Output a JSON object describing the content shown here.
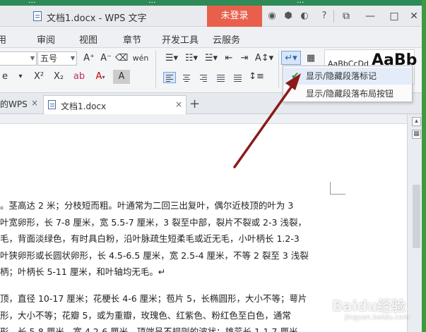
{
  "desktop_strip": [
    "...",
    "...",
    "..."
  ],
  "titlebar": {
    "doc_title": "文档1.docx - WPS 文字",
    "login_label": "未登录"
  },
  "menu": [
    "审阅",
    "视图",
    "章节",
    "开发工具",
    "云服务"
  ],
  "ribbon": {
    "font_size": "五号",
    "font_grow": "A⁺",
    "font_shrink": "A⁻",
    "superscript": "X²",
    "subscript": "X₂",
    "style_normal": "AaBbCcDd",
    "style_heading": "AaBb"
  },
  "tabs": {
    "prev_tab": "的WPS",
    "active_tab": "文档1.docx",
    "close_symbol": "×",
    "add_symbol": "+"
  },
  "dropdown": {
    "items": [
      "显示/隐藏段落标记",
      "显示/隐藏段落布局按钮"
    ]
  },
  "document": {
    "para1": [
      "。茎高达 2 米；分枝短而粗。叶通常为二回三出复叶，偶尔近枝顶的叶为 3",
      "叶宽卵形，长 7-8 厘米，宽 5.5-7 厘米，3 裂至中部，裂片不裂或 2-3 浅裂，",
      "毛，背面淡绿色，有时具白粉，沿叶脉疏生短柔毛或近无毛，小叶柄长 1.2-3",
      "叶狭卵形或长圆状卵形，长 4.5-6.5 厘米，宽 2.5-4 厘米，不等 2 裂至 3 浅裂",
      "柄；叶柄长 5-11 厘米，和叶轴均无毛。↵"
    ],
    "para2": [
      "顶，直径 10-17 厘米；花梗长 4-6 厘米；苞片 5，长椭圆形，大小不等；萼片",
      "形，大小不等；花瓣 5，或为重瓣，玫瑰色、红紫色、粉红色至白色，通常",
      "形，长 5-8 厘米，宽 4.2-6 厘米，顶端呈不规则的波状；雄蕊长 1-1.7 厘米"
    ]
  },
  "watermark": {
    "main": "Baidu经验",
    "sub": "jingyan.baidu.com"
  },
  "colors": {
    "login_bg": "#e8604c",
    "arrow": "#8b1a1a",
    "check": "#2b8f3a"
  }
}
